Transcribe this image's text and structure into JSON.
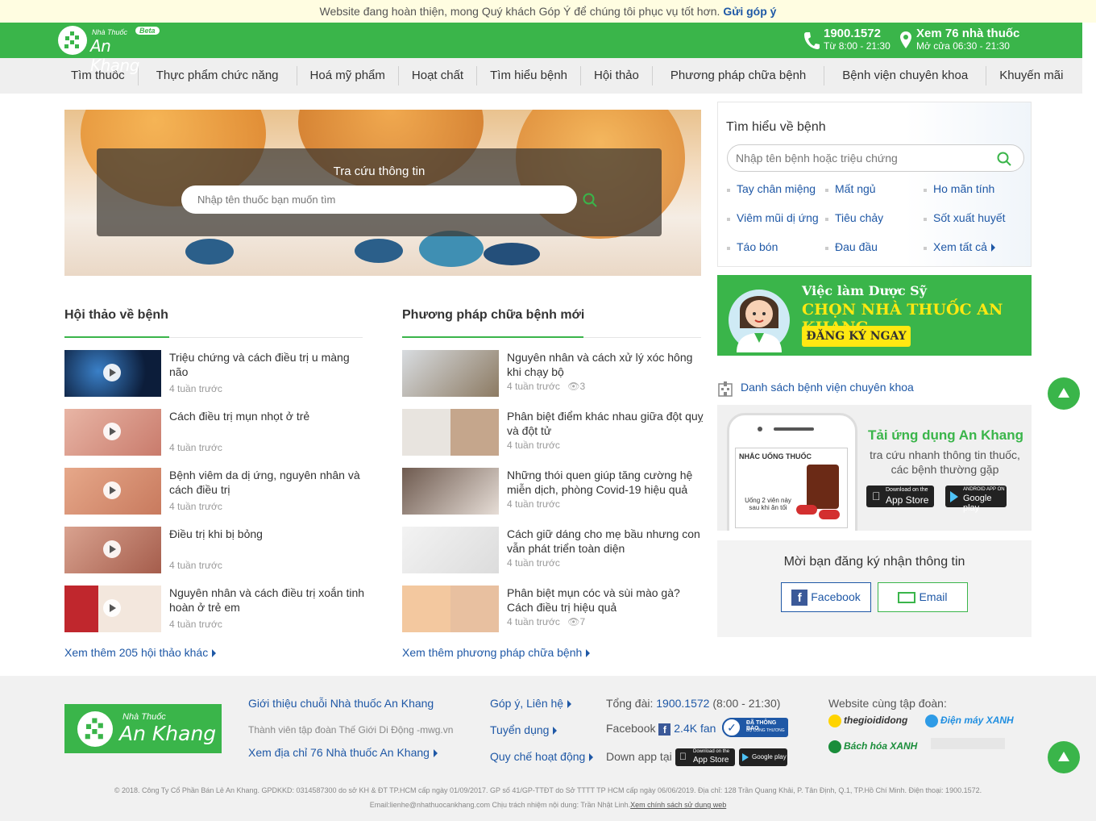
{
  "notice": {
    "text": "Website đang hoàn thiện, mong Quý khách Góp Ý để chúng tôi phục vụ tốt hơn.",
    "link": "Gửi góp ý"
  },
  "brand": {
    "small": "Nhà Thuốc",
    "name": "An Khang",
    "badge": "Beta"
  },
  "header": {
    "phone": "1900.1572",
    "phone_hours": "Từ 8:00 - 21:30",
    "stores": "Xem 76 nhà thuốc",
    "stores_hours": "Mở cửa 06:30 - 21:30"
  },
  "nav": [
    "Tìm thuốc",
    "Thực phẩm chức năng",
    "Hoá mỹ phẩm",
    "Hoạt chất",
    "Tìm hiểu bệnh",
    "Hội thảo",
    "Phương pháp chữa bệnh",
    "Bệnh viện chuyên khoa",
    "Khuyến mãi"
  ],
  "hero": {
    "title": "Tra cứu thông tin",
    "placeholder": "Nhập tên thuốc bạn muốn tìm"
  },
  "seminars": {
    "title": "Hội thảo về bệnh",
    "items": [
      {
        "title": "Triệu chứng và cách điều trị u màng não",
        "time": "4 tuần trước"
      },
      {
        "title": "Cách điều trị mụn nhọt ở trẻ",
        "time": "4 tuần trước"
      },
      {
        "title": "Bệnh viêm da dị ứng, nguyên nhân và cách điều trị",
        "time": "4 tuần trước"
      },
      {
        "title": "Điều trị khi bị bỏng",
        "time": "4 tuần trước"
      },
      {
        "title": "Nguyên nhân và cách điều trị xoắn tinh hoàn ở trẻ em",
        "time": "4 tuần trước"
      }
    ],
    "more": "Xem thêm 205 hội thảo khác"
  },
  "methods": {
    "title": "Phương pháp chữa bệnh mới",
    "items": [
      {
        "title": "Nguyên nhân và cách xử lý xóc hông khi chạy bộ",
        "time": "4 tuần trước",
        "views": "3"
      },
      {
        "title": "Phân biệt điểm khác nhau giữa đột quỵ và đột tử",
        "time": "4 tuần trước",
        "views": ""
      },
      {
        "title": "Những thói quen giúp tăng cường hệ miễn dịch, phòng Covid-19 hiệu quả",
        "time": "4 tuần trước",
        "views": ""
      },
      {
        "title": "Cách giữ dáng cho mẹ bầu nhưng con vẫn phát triển toàn diện",
        "time": "4 tuần trước",
        "views": ""
      },
      {
        "title": "Phân biệt mụn cóc và sùi mào gà? Cách điều trị hiệu quả",
        "time": "4 tuần trước",
        "views": "7"
      }
    ],
    "more": "Xem thêm phương pháp chữa bệnh"
  },
  "disease_box": {
    "title": "Tìm hiểu về bệnh",
    "placeholder": "Nhập tên bệnh hoặc triệu chứng",
    "items": [
      "Tay chân miệng",
      "Mất ngủ",
      "Ho mãn tính",
      "Viêm mũi dị ứng",
      "Tiêu chảy",
      "Sốt xuất huyết",
      "Táo bón",
      "Đau đầu",
      "Xem tất cả"
    ]
  },
  "job_banner": {
    "line1": "Việc làm Dược Sỹ",
    "line2": "CHỌN NHÀ THUỐC AN KHANG",
    "button": "ĐĂNG KÝ NGAY"
  },
  "hospitals_link": "Danh sách bệnh viện chuyên khoa",
  "app_box": {
    "title": "Tải ứng dụng An Khang",
    "desc": "tra cứu nhanh thông tin thuốc, các bệnh thường gặp",
    "phone_header": "NHẮC UỐNG THUỐC",
    "phone_text": "Uống 2 viên này sau khi ăn tối",
    "appstore_small": "Download on the",
    "appstore": "App Store",
    "googleplay_small": "ANDROID APP ON",
    "googleplay": "Google play"
  },
  "subscribe": {
    "title": "Mời bạn đăng ký nhận thông tin",
    "facebook": "Facebook",
    "email": "Email"
  },
  "footer": {
    "intro": "Giới thiệu chuỗi Nhà thuốc An Khang",
    "member": "Thành viên tập đoàn Thế Giới Di Động -mwg.vn",
    "addresses": "Xem địa chỉ 76 Nhà thuốc An Khang",
    "feedback": "Góp ý, Liên hệ",
    "recruit": "Tuyển dụng",
    "rules": "Quy chế hoạt động",
    "hotline_label": "Tổng đài:",
    "hotline": "1900.1572",
    "hotline_hours": "(8:00 - 21:30)",
    "facebook_label": "Facebook",
    "facebook_fans": "2.4K fan",
    "registered": "ĐÃ THÔNG BÁO",
    "registered_sub": "BỘ CÔNG THƯƠNG",
    "download_label": "Down app tại",
    "group_label": "Website cùng tập đoàn:",
    "group": [
      "thegioididong",
      "Điện máy XANH",
      "Bách hóa XANH"
    ],
    "copyright": "© 2018. Công Ty Cổ Phần Bán Lẻ An Khang. GPDKKD: 0314587300 do sở KH & ĐT TP.HCM cấp ngày 01/09/2017. GP số 41/GP-TTĐT do Sở TTTT TP HCM cấp ngày 06/06/2019. Địa chỉ: 128 Trần Quang Khải, P. Tân Định, Q.1, TP.Hồ Chí Minh. Điện thoại: 1900.1572.",
    "contact": "Email:lienhe@nhathuocankhang.com Chịu trách nhiệm nội dung: Trần Nhật Linh.",
    "policy": "Xem chính sách sử dụng web"
  },
  "colors": {
    "brand_green": "#3ab54a",
    "link_blue": "#1f58a6",
    "banner_yellow": "#ffe812"
  }
}
